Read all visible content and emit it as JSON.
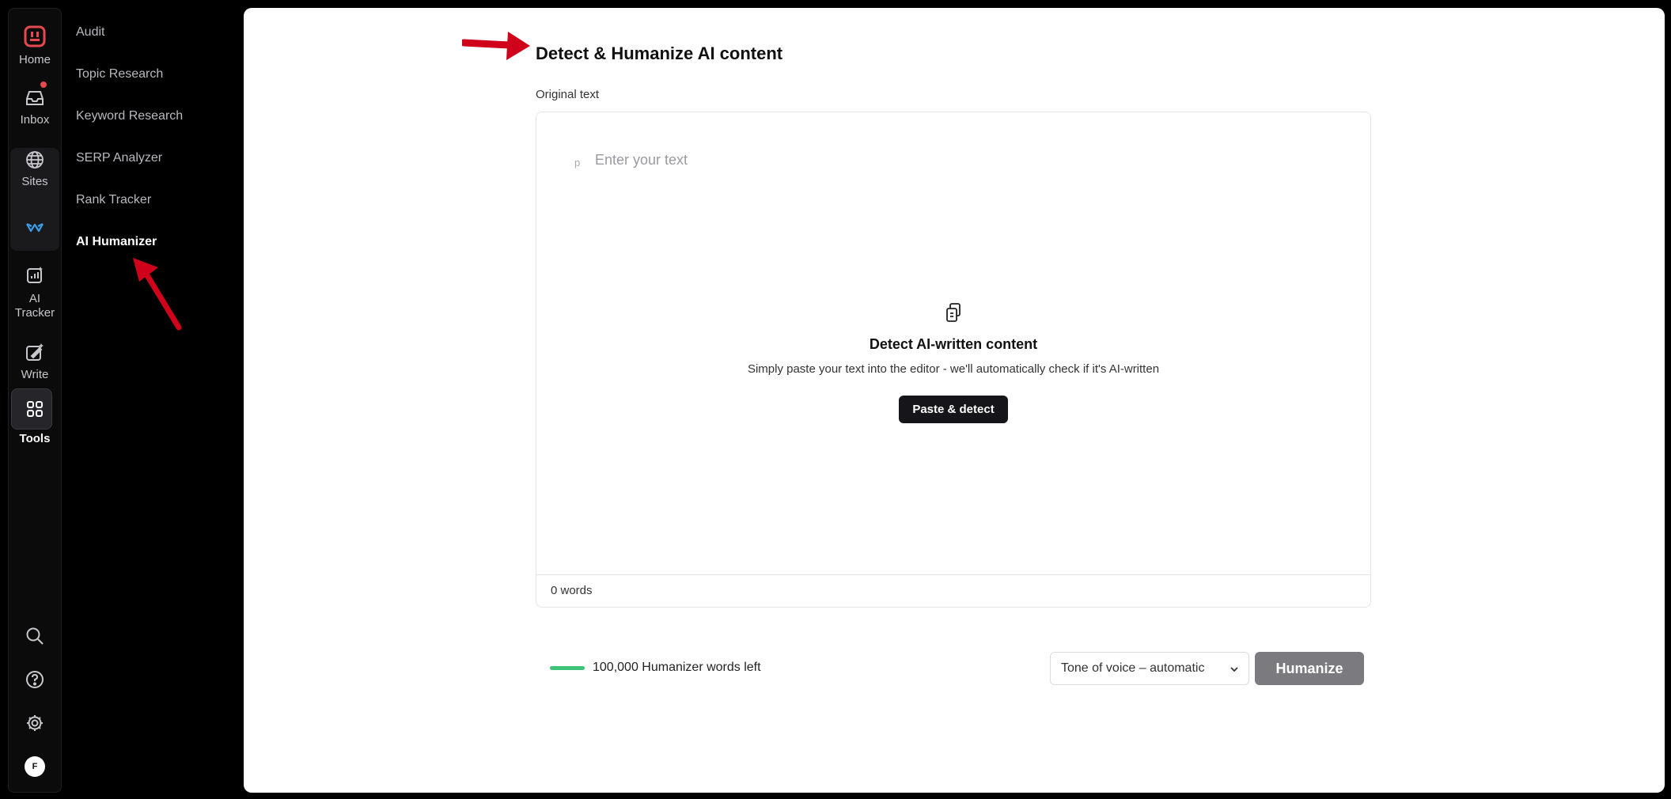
{
  "rail": {
    "home_label": "Home",
    "inbox_label": "Inbox",
    "sites_label": "Sites",
    "ai_tracker_label": "AI Tracker",
    "write_label": "Write",
    "tools_label": "Tools",
    "avatar_initial": "F"
  },
  "subnav": {
    "items": [
      {
        "label": "Audit"
      },
      {
        "label": "Topic Research"
      },
      {
        "label": "Keyword Research"
      },
      {
        "label": "SERP Analyzer"
      },
      {
        "label": "Rank Tracker"
      },
      {
        "label": "AI Humanizer"
      }
    ],
    "active_item": "AI Humanizer"
  },
  "main": {
    "title": "Detect & Humanize AI content",
    "field_label": "Original text",
    "editor": {
      "paragraph_tag": "p",
      "placeholder": "Enter your text",
      "empty_title": "Detect AI-written content",
      "empty_description": "Simply paste your text into the editor - we'll automatically check if it's AI-written",
      "paste_button": "Paste & detect",
      "word_count": "0 words"
    },
    "quota_text": "100,000 Humanizer words left",
    "tone_select": "Tone of voice – automatic",
    "humanize_button": "Humanize"
  },
  "colors": {
    "brand_red": "#e5484d",
    "active_blue": "#3b9eea",
    "quota_green": "#3ec27a",
    "annotation_red": "#d0021b"
  },
  "icons": {
    "home": "brand-logo-icon",
    "inbox": "inbox-tray-icon",
    "sites": "globe-icon",
    "active_site": "crown-zigzag-icon",
    "ai_tracker": "chart-sparkle-icon",
    "write": "pen-sparkle-icon",
    "tools": "grid-four-icon",
    "search": "search-icon",
    "help": "help-circle-icon",
    "settings": "gear-icon",
    "clipboard": "copy-clipboard-icon",
    "select": "chevron-down-icon"
  }
}
